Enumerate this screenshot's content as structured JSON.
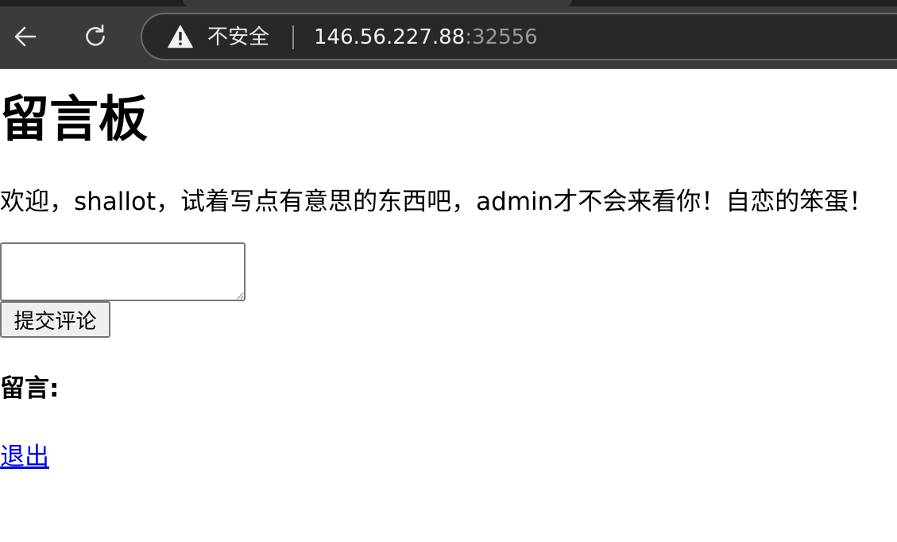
{
  "browser": {
    "security_label": "不安全",
    "url_host": "146.56.227.88",
    "url_port": ":32556",
    "back_icon": "arrow-left-icon",
    "reload_icon": "reload-icon",
    "warning_icon": "warning-triangle-icon"
  },
  "page": {
    "title": "留言板",
    "welcome_text": "欢迎，shallot，试着写点有意思的东西吧，admin才不会来看你！自恋的笨蛋！",
    "comment_input_value": "",
    "submit_label": "提交评论",
    "comments_heading": "留言:",
    "logout_label": "退出"
  },
  "colors": {
    "chrome_bg": "#3b3b3b",
    "omnibox_bg": "#282828",
    "link": "#0000ee"
  }
}
